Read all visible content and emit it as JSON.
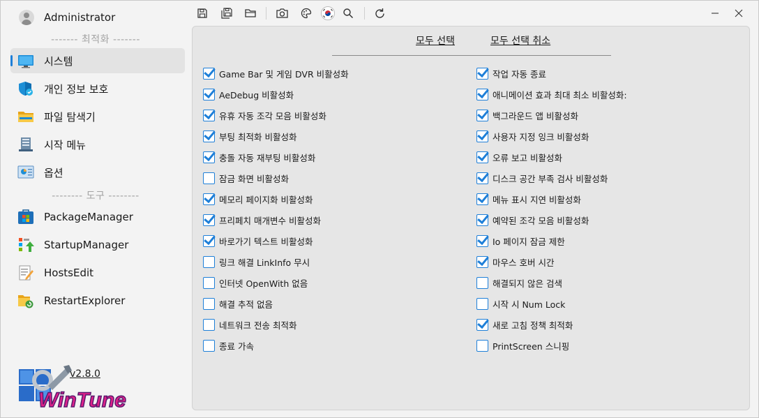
{
  "user": {
    "name": "Administrator"
  },
  "sections": {
    "optimize": "------- 최적화 -------",
    "tools": "-------- 도구 --------"
  },
  "nav": [
    {
      "label": "시스템",
      "icon": "monitor-icon",
      "active": true
    },
    {
      "label": "개인 정보 보호",
      "icon": "shield-icon",
      "active": false
    },
    {
      "label": "파일 탐색기",
      "icon": "folder-icon",
      "active": false
    },
    {
      "label": "시작 메뉴",
      "icon": "start-menu-icon",
      "active": false
    },
    {
      "label": "옵션",
      "icon": "options-icon",
      "active": false
    }
  ],
  "tools": [
    {
      "label": "PackageManager",
      "icon": "package-icon"
    },
    {
      "label": "StartupManager",
      "icon": "startup-icon"
    },
    {
      "label": "HostsEdit",
      "icon": "hosts-edit-icon"
    },
    {
      "label": "RestartExplorer",
      "icon": "restart-explorer-icon"
    }
  ],
  "app": {
    "version": "v2.8.0",
    "logo_text": "WinTune"
  },
  "toolbar": [
    "save-icon",
    "save-as-icon",
    "open-folder-icon",
    "camera-icon",
    "palette-icon",
    "flag-korea-icon",
    "search-icon",
    "refresh-icon"
  ],
  "window": [
    "minimize-icon",
    "close-icon"
  ],
  "main": {
    "select_all": "모두 선택",
    "deselect_all": "모두 선택 취소",
    "left_options": [
      {
        "label": "Game Bar 및 게임 DVR 비활성화",
        "checked": true
      },
      {
        "label": "AeDebug 비활성화",
        "checked": true
      },
      {
        "label": "유휴 자동 조각 모음 비활성화",
        "checked": true
      },
      {
        "label": "부팅 최적화 비활성화",
        "checked": true
      },
      {
        "label": "충돌 자동 재부팅 비활성화",
        "checked": true
      },
      {
        "label": "잠금 화면 비활성화",
        "checked": false
      },
      {
        "label": "메모리 페이지화 비활성화",
        "checked": true
      },
      {
        "label": "프리페치 매개변수 비활성화",
        "checked": true
      },
      {
        "label": "바로가기 텍스트 비활성화",
        "checked": true
      },
      {
        "label": "링크 해결 LinkInfo 무시",
        "checked": false
      },
      {
        "label": "인터넷 OpenWith 없음",
        "checked": false
      },
      {
        "label": "해결 추적 없음",
        "checked": false
      },
      {
        "label": "네트워크 전송 최적화",
        "checked": false
      },
      {
        "label": "종료 가속",
        "checked": false
      }
    ],
    "right_options": [
      {
        "label": "작업 자동 종료",
        "checked": true
      },
      {
        "label": "애니메이션 효과 최대 최소 비활성화:",
        "checked": true
      },
      {
        "label": "백그라운드 앱 비활성화",
        "checked": true
      },
      {
        "label": "사용자 지정 잉크 비활성화",
        "checked": true
      },
      {
        "label": "오류 보고 비활성화",
        "checked": true
      },
      {
        "label": "디스크 공간 부족 검사 비활성화",
        "checked": true
      },
      {
        "label": "메뉴 표시 지연 비활성화",
        "checked": true
      },
      {
        "label": "예약된 조각 모음 비활성화",
        "checked": true
      },
      {
        "label": "Io 페이지 잠금 제한",
        "checked": true
      },
      {
        "label": "마우스 호버 시간",
        "checked": true
      },
      {
        "label": "해결되지 않은 검색",
        "checked": false
      },
      {
        "label": "시작 시 Num Lock",
        "checked": false
      },
      {
        "label": "새로 고침 정책 최적화",
        "checked": true
      },
      {
        "label": "PrintScreen 스니핑",
        "checked": false
      }
    ]
  },
  "colors": {
    "accent": "#1e7fd8",
    "panel": "#e6e6e6",
    "background": "#f3f3f3"
  }
}
